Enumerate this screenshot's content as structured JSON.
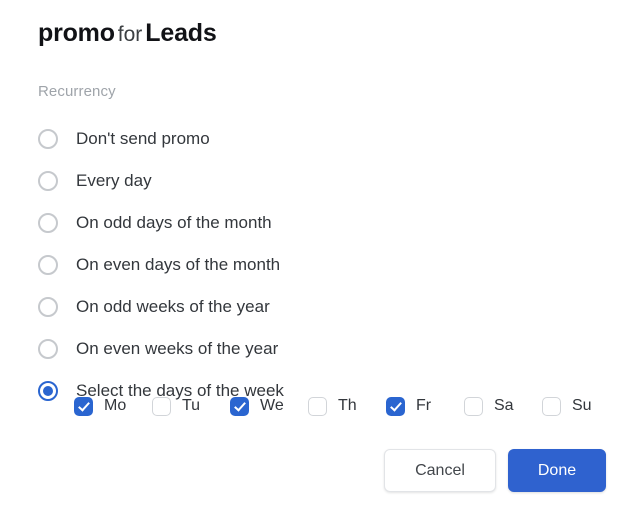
{
  "dialog": {
    "title": {
      "subject": "promo",
      "connector": "for",
      "object": "Leads"
    },
    "section_label": "Recurrency",
    "accent_color": "#2f62cf",
    "recurrency": {
      "selected_index": 6,
      "options": [
        {
          "label": "Don't send promo",
          "selected": false
        },
        {
          "label": "Every day",
          "selected": false
        },
        {
          "label": "On odd days of the month",
          "selected": false
        },
        {
          "label": "On even days of the month",
          "selected": false
        },
        {
          "label": "On odd weeks of the year",
          "selected": false
        },
        {
          "label": "On even weeks of the year",
          "selected": false
        },
        {
          "label": "Select the days of the week",
          "selected": true
        }
      ]
    },
    "days": [
      {
        "label": "Mo",
        "checked": true
      },
      {
        "label": "Tu",
        "checked": false
      },
      {
        "label": "We",
        "checked": true
      },
      {
        "label": "Th",
        "checked": false
      },
      {
        "label": "Fr",
        "checked": true
      },
      {
        "label": "Sa",
        "checked": false
      },
      {
        "label": "Su",
        "checked": false
      }
    ],
    "buttons": {
      "cancel_label": "Cancel",
      "done_label": "Done"
    }
  }
}
